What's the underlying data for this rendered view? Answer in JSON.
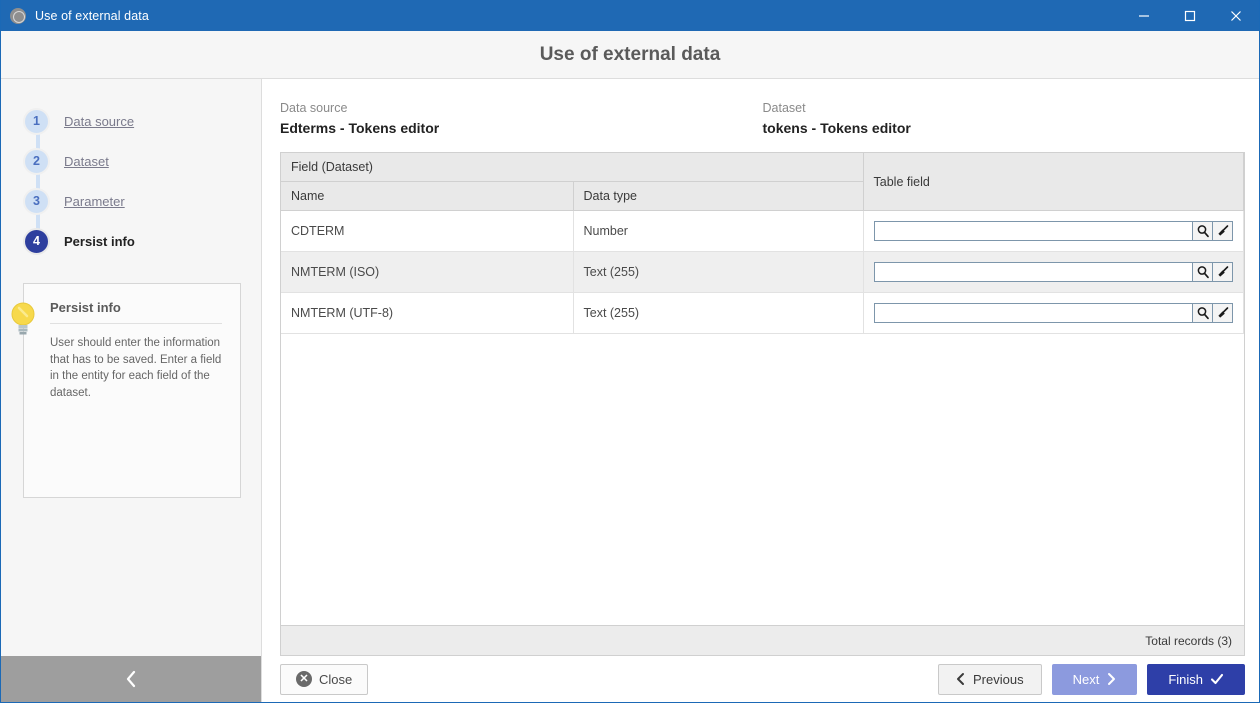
{
  "window": {
    "title": "Use of external data",
    "icon": "globe-icon",
    "controls": {
      "minimize": "minimize-icon",
      "maximize": "maximize-icon",
      "close": "close-icon"
    }
  },
  "dialog": {
    "title": "Use of external data"
  },
  "sidebar": {
    "steps": [
      {
        "number": "1",
        "label": "Data source",
        "state": "done"
      },
      {
        "number": "2",
        "label": "Dataset",
        "state": "done"
      },
      {
        "number": "3",
        "label": "Parameter",
        "state": "done"
      },
      {
        "number": "4",
        "label": "Persist info",
        "state": "current"
      }
    ],
    "info": {
      "icon": "lightbulb-icon",
      "title": "Persist info",
      "text": "User should enter the information that has to be saved. Enter a field in the entity for each field of the dataset."
    },
    "collapse": {
      "icon": "chevron-left-icon"
    }
  },
  "summary": {
    "datasource_label": "Data source",
    "datasource_value": "Edterms - Tokens editor",
    "dataset_label": "Dataset",
    "dataset_value": "tokens - Tokens editor"
  },
  "grid": {
    "group_header": "Field (Dataset)",
    "columns": [
      "Name",
      "Data type"
    ],
    "tablefield_header": "Table field",
    "rows": [
      {
        "name": "CDTERM",
        "datatype": "Number",
        "value": "",
        "placeholder": ""
      },
      {
        "name": "NMTERM (ISO)",
        "datatype": "Text (255)",
        "value": "",
        "placeholder": ""
      },
      {
        "name": "NMTERM (UTF-8)",
        "datatype": "Text (255)",
        "value": "",
        "placeholder": ""
      }
    ],
    "row_icons": {
      "search": "search-icon",
      "clear": "broom-icon"
    },
    "footer_total": "Total records (3)"
  },
  "footer": {
    "close_label": "Close",
    "previous_label": "Previous",
    "next_label": "Next",
    "finish_label": "Finish"
  },
  "colors": {
    "titlebar": "#1f69b4",
    "accent": "#2e3fa8",
    "next_disabled": "#8c9ade",
    "step_done": "#cfe0f5",
    "input_border": "#7d96ab"
  }
}
